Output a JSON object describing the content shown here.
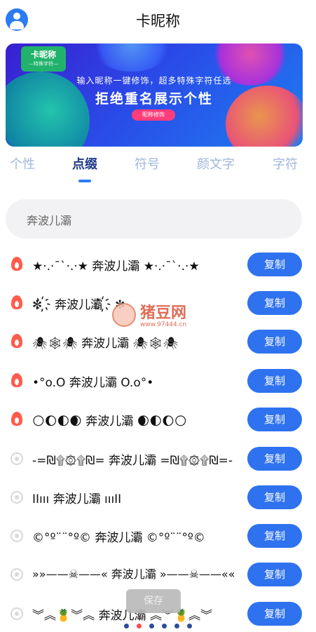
{
  "header": {
    "title": "卡昵称"
  },
  "banner": {
    "badge_title": "卡昵称",
    "badge_sub": "—特殊字符—",
    "line1": "输入昵称一键修饰，超多特殊字符任选",
    "line2": "拒绝重名展示个性",
    "pill": "昵称修饰"
  },
  "tabs": [
    {
      "label": "个性"
    },
    {
      "label": "点缀"
    },
    {
      "label": "符号"
    },
    {
      "label": "颜文字"
    },
    {
      "label": "字符"
    }
  ],
  "active_tab": "点缀",
  "search": {
    "value": "奔波儿灞"
  },
  "copy_label": "复制",
  "rows": [
    {
      "text": "★·.·¯`·.·★ 奔波儿灞 ★·.·¯`·.·★",
      "hot": true
    },
    {
      "text": "✼ ҉ 奔波儿灞 ҉ ✼",
      "hot": true
    },
    {
      "text": "🕷🕸🕷 奔波儿灞 🕷🕸🕷",
      "hot": true
    },
    {
      "text": "•°o.O 奔波儿灞 O.o°•",
      "hot": true
    },
    {
      "text": "🌕🌔🌓🌒 奔波儿灞 🌒🌓🌔🌕",
      "hot": true
    },
    {
      "text": "-=₪۩۞۩₪= 奔波儿灞 =₪۩۞۩₪=-",
      "hot": false
    },
    {
      "text": "ΙΙııı 奔波儿灞 ıııΙΙ",
      "hot": false
    },
    {
      "text": "©°º¨¨°º© 奔波儿灞 ©°º¨¨°º©",
      "hot": false
    },
    {
      "text": "»»——☠——« 奔波儿灞 »——☠——««",
      "hot": false
    },
    {
      "text": "︾︽🍍︾︽ 奔波儿灞 ︽︾🍍︽︾",
      "hot": false
    }
  ],
  "watermark": {
    "name": "猪豆网",
    "url": "www.97444.cn"
  },
  "save_label": "保存",
  "pager": {
    "count": 6,
    "active": 1
  }
}
